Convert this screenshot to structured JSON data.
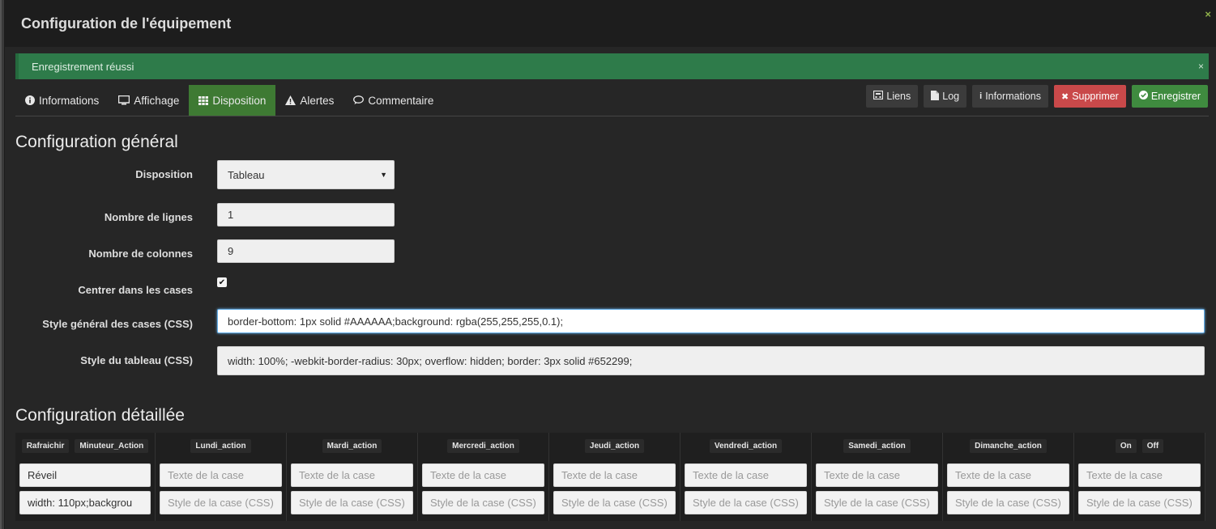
{
  "modal": {
    "title": "Configuration de l'équipement",
    "close": "×"
  },
  "alert": {
    "message": "Enregistrement réussi",
    "close": "×"
  },
  "tabs": [
    {
      "label": "Informations",
      "icon": "info-circle-icon"
    },
    {
      "label": "Affichage",
      "icon": "monitor-icon"
    },
    {
      "label": "Disposition",
      "icon": "grid-icon"
    },
    {
      "label": "Alertes",
      "icon": "warning-icon"
    },
    {
      "label": "Commentaire",
      "icon": "comment-icon"
    }
  ],
  "actions": {
    "liens": "Liens",
    "log": "Log",
    "informations": "Informations",
    "supprimer": "Supprimer",
    "enregistrer": "Enregistrer"
  },
  "general": {
    "title": "Configuration général",
    "disposition_label": "Disposition",
    "disposition_value": "Tableau",
    "rows_label": "Nombre de lignes",
    "rows_value": "1",
    "cols_label": "Nombre de colonnes",
    "cols_value": "9",
    "center_label": "Centrer dans les cases",
    "center_checked": true,
    "cell_style_label": "Style général des cases (CSS)",
    "cell_style_value": "border-bottom: 1px solid #AAAAAA;background: rgba(255,255,255,0.1);",
    "table_style_label": "Style du tableau (CSS)",
    "table_style_value": "width: 100%; -webkit-border-radius: 30px; overflow: hidden; border: 3px solid #652299;"
  },
  "detailed": {
    "title": "Configuration détaillée",
    "placeholder_text": "Texte de la case",
    "placeholder_style": "Style de la case (CSS)",
    "columns": [
      {
        "headers": [
          "Rafraichir",
          "Minuteur_Action"
        ],
        "text": "Réveil",
        "style": "width: 110px;backgrou"
      },
      {
        "headers": [
          "Lundi_action"
        ]
      },
      {
        "headers": [
          "Mardi_action"
        ]
      },
      {
        "headers": [
          "Mercredi_action"
        ]
      },
      {
        "headers": [
          "Jeudi_action"
        ]
      },
      {
        "headers": [
          "Vendredi_action"
        ]
      },
      {
        "headers": [
          "Samedi_action"
        ]
      },
      {
        "headers": [
          "Dimanche_action"
        ]
      },
      {
        "headers": [
          "On",
          "Off"
        ]
      }
    ]
  },
  "colors": {
    "active_tab": "#3e7a33",
    "alert": "#2e7b4a",
    "danger": "#c9494a",
    "success": "#3f8b3f"
  }
}
